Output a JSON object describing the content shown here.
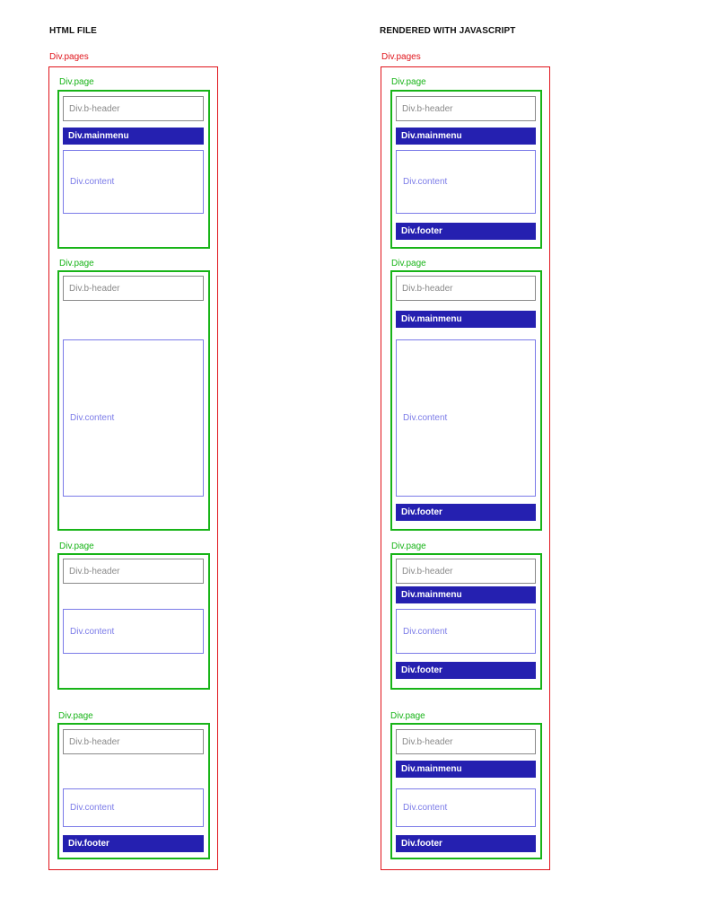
{
  "columns": {
    "left_title": "HTML FILE",
    "right_title": "RENDERED WITH JAVASCRIPT"
  },
  "labels": {
    "pages": "Div.pages",
    "page": "Div.page",
    "header": "Div.b-header",
    "menu": "Div.mainmenu",
    "content": "Div.content",
    "footer": "Div.footer"
  },
  "colors": {
    "pages_border": "#e0141b",
    "page_border": "#18b418",
    "header_border": "#8a8a8a",
    "menu_fill": "#2520b0",
    "content_border": "#7b7be8"
  }
}
